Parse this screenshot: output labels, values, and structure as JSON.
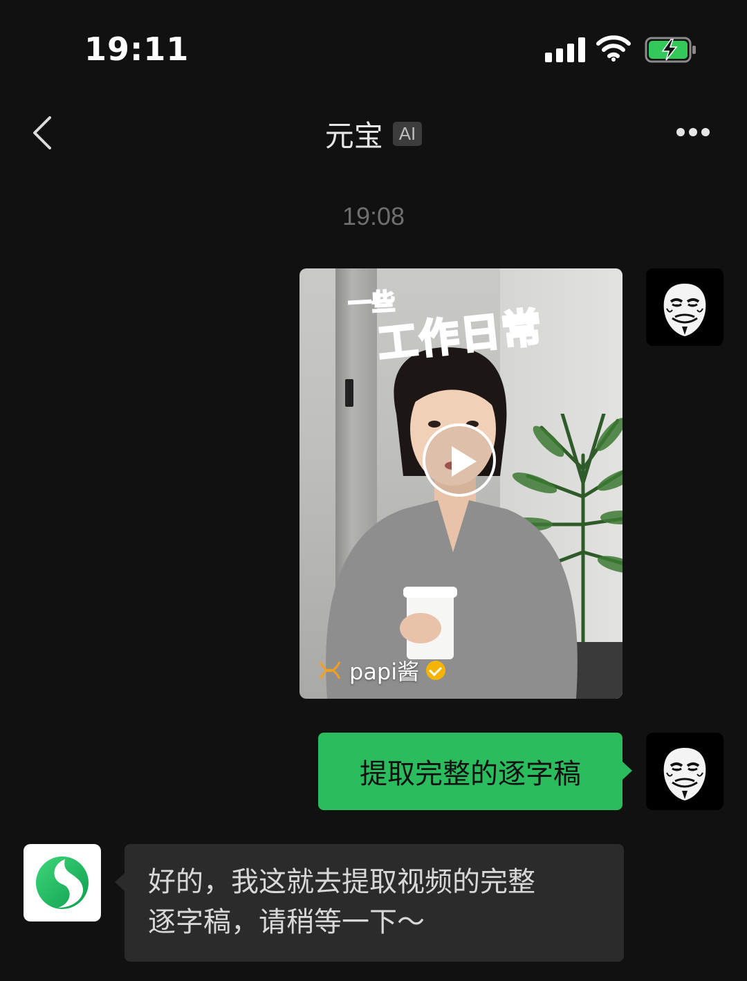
{
  "status_bar": {
    "time": "19:11"
  },
  "nav": {
    "title": "元宝",
    "badge": "AI"
  },
  "chat": {
    "timestamp": "19:08",
    "video_card": {
      "overlay_small": "一些",
      "overlay_large": "工作日常",
      "author": "papi酱"
    },
    "user_message": "提取完整的逐字稿",
    "bot_message_line1": "好的，我这就去提取视频的完整",
    "bot_message_line2": "逐字稿，请稍等一下～"
  },
  "colors": {
    "background": "#111111",
    "user_bubble": "#2bbc5e",
    "bot_bubble": "#2b2b2b",
    "battery_green": "#34c759",
    "overlay_pink": "#e8228f"
  },
  "icons": {
    "back": "chevron-left-icon",
    "more": "more-horizontal-icon",
    "signal": "signal-icon",
    "wifi": "wifi-icon",
    "battery": "battery-charging-icon",
    "play": "play-icon",
    "verified": "verified-check-icon",
    "user_avatar": "guy-fawkes-mask",
    "bot_avatar": "yuanbao-logo"
  }
}
